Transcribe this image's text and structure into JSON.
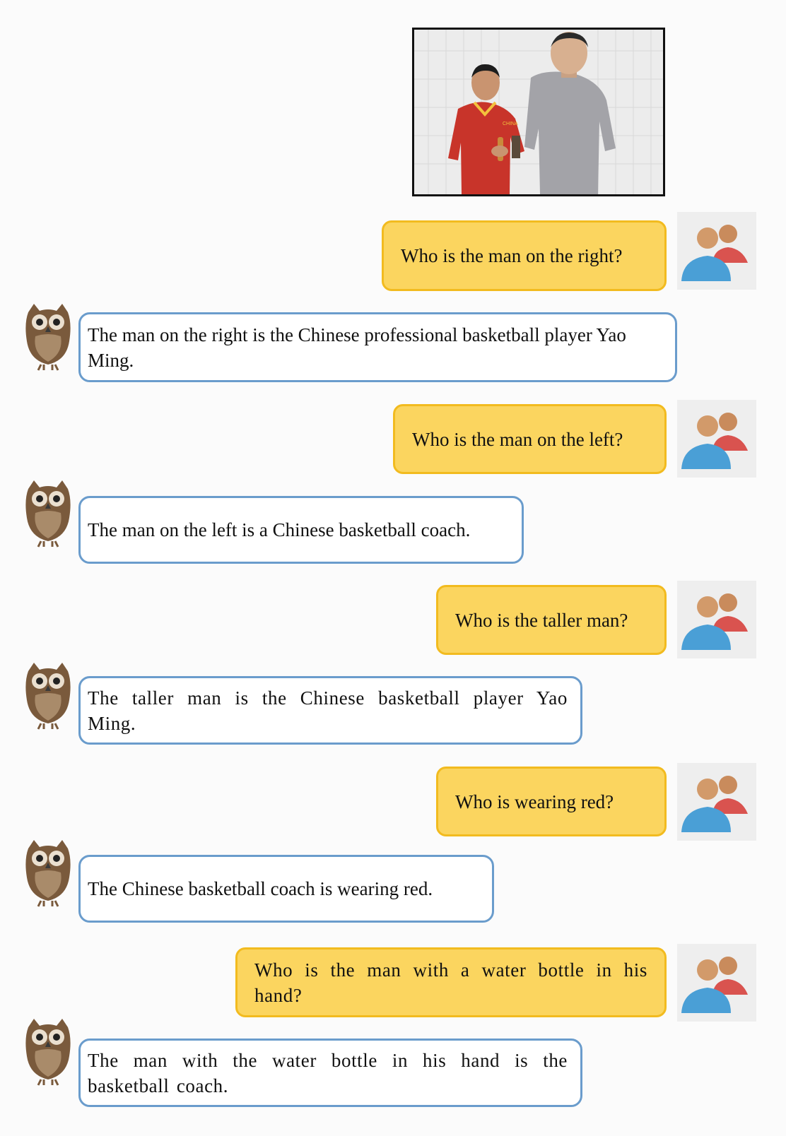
{
  "photo": {
    "shirt_text": "CHINA",
    "colors": {
      "red_shirt": "#c8342a",
      "grey_shirt": "#a3a3a8",
      "curtain": "#ececec"
    }
  },
  "conversation": [
    {
      "role": "user",
      "text": "Who is the man on the right?"
    },
    {
      "role": "assistant",
      "text": "The man on the right is the Chinese professional basketball player Yao Ming."
    },
    {
      "role": "user",
      "text": "Who is the man on the left?"
    },
    {
      "role": "assistant",
      "text": "The man on the left is a Chinese basketball coach."
    },
    {
      "role": "user",
      "text": "Who is the taller man?"
    },
    {
      "role": "assistant",
      "text": "The taller man is the Chinese basketball player Yao Ming."
    },
    {
      "role": "user",
      "text": "Who is wearing red?"
    },
    {
      "role": "assistant",
      "text": "The Chinese basketball coach is wearing red."
    },
    {
      "role": "user",
      "text": "Who is the man with a water bottle in his hand?"
    },
    {
      "role": "assistant",
      "text": "The man with the water bottle in his hand is the basketball coach."
    }
  ],
  "icons": {
    "user_avatar": "users-icon",
    "assistant_avatar": "owl-icon"
  },
  "colors": {
    "user_bubble": "#fbd55f",
    "user_border": "#f2bb1f",
    "assistant_border": "#6a9ccc",
    "background": "#fbfbfb",
    "avatar_blue": "#4a9fd6",
    "avatar_red": "#d9534f",
    "avatar_skin": "#d29a6a"
  }
}
